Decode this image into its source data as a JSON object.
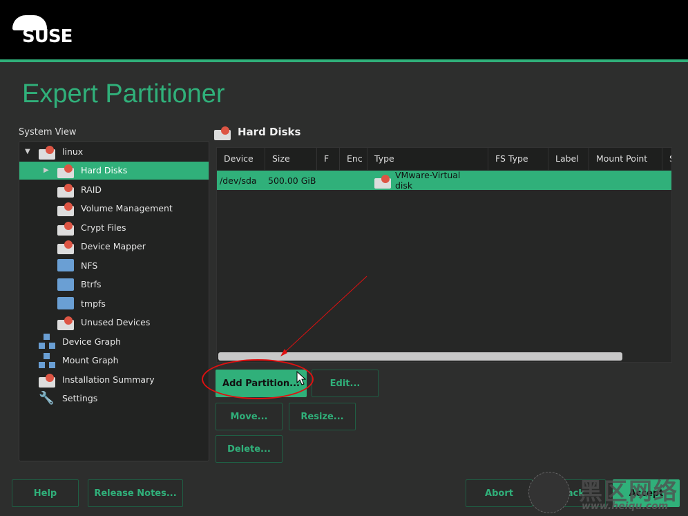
{
  "header": {
    "brand": "SUSE"
  },
  "page_title": "Expert Partitioner",
  "system_view": {
    "label": "System View",
    "items": [
      {
        "label": "linux",
        "icon": "disk-icon",
        "expanded": true
      },
      {
        "label": "Hard Disks",
        "icon": "disk-icon",
        "selected": true
      },
      {
        "label": "RAID",
        "icon": "raid-icon"
      },
      {
        "label": "Volume Management",
        "icon": "disk-icon"
      },
      {
        "label": "Crypt Files",
        "icon": "crypt-icon"
      },
      {
        "label": "Device Mapper",
        "icon": "device-mapper-icon"
      },
      {
        "label": "NFS",
        "icon": "folder-icon"
      },
      {
        "label": "Btrfs",
        "icon": "folder-icon"
      },
      {
        "label": "tmpfs",
        "icon": "folder-icon"
      },
      {
        "label": "Unused Devices",
        "icon": "unused-icon"
      },
      {
        "label": "Device Graph",
        "icon": "graph-icon"
      },
      {
        "label": "Mount Graph",
        "icon": "graph-icon"
      },
      {
        "label": "Installation Summary",
        "icon": "disk-icon"
      },
      {
        "label": "Settings",
        "icon": "wrench-icon"
      }
    ]
  },
  "main": {
    "title": "Hard Disks",
    "columns": [
      "Device",
      "Size",
      "F",
      "Enc",
      "Type",
      "FS Type",
      "Label",
      "Mount Point",
      "Sta"
    ],
    "rows": [
      {
        "device": "/dev/sda",
        "size": "500.00 GiB",
        "f": "",
        "enc": "",
        "type": "VMware-Virtual disk",
        "fs_type": "",
        "label": "",
        "mount_point": "",
        "start": ""
      }
    ]
  },
  "buttons": {
    "add_partition": "Add Partition...",
    "edit": "Edit...",
    "move": "Move...",
    "resize": "Resize...",
    "delete": "Delete...",
    "help": "Help",
    "release_notes": "Release Notes...",
    "abort": "Abort",
    "back": "Back",
    "accept": "Accept"
  },
  "watermark": {
    "text": "黑区网络",
    "url": "www.heiqu.com"
  },
  "colors": {
    "accent": "#30b07a",
    "annotation": "#e01010"
  }
}
